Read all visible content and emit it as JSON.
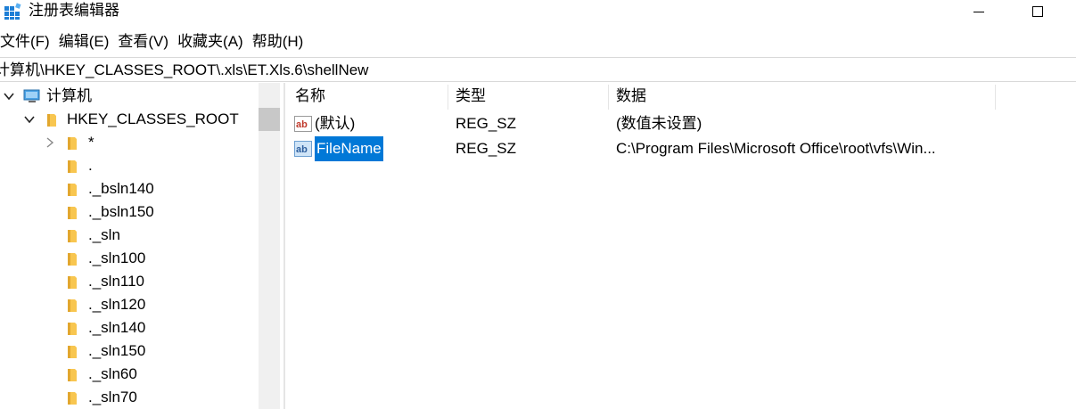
{
  "window": {
    "title": "注册表编辑器",
    "icons": {
      "app": "registry-editor-icon",
      "minimize": "minimize-icon",
      "maximize": "maximize-icon"
    }
  },
  "menu": [
    "文件(F)",
    "编辑(E)",
    "查看(V)",
    "收藏夹(A)",
    "帮助(H)"
  ],
  "address": "计算机\\HKEY_CLASSES_ROOT\\.xls\\ET.Xls.6\\shellNew",
  "tree": {
    "root": "计算机",
    "hive": "HKEY_CLASSES_ROOT",
    "keys": [
      "*",
      ".",
      "._bsln140",
      "._bsln150",
      "._sln",
      "._sln100",
      "._sln110",
      "._sln120",
      "._sln140",
      "._sln150",
      "._sln60",
      "._sln70"
    ]
  },
  "list": {
    "columns": [
      "名称",
      "类型",
      "数据"
    ],
    "rows": [
      {
        "name": "(默认)",
        "type": "REG_SZ",
        "data": "(数值未设置)"
      },
      {
        "name": "FileName",
        "type": "REG_SZ",
        "data": "C:\\Program Files\\Microsoft Office\\root\\vfs\\Win..."
      }
    ]
  },
  "colors": {
    "selection": "#0078d7",
    "folder": "#f8c650",
    "folder_dark": "#e2a72e"
  }
}
